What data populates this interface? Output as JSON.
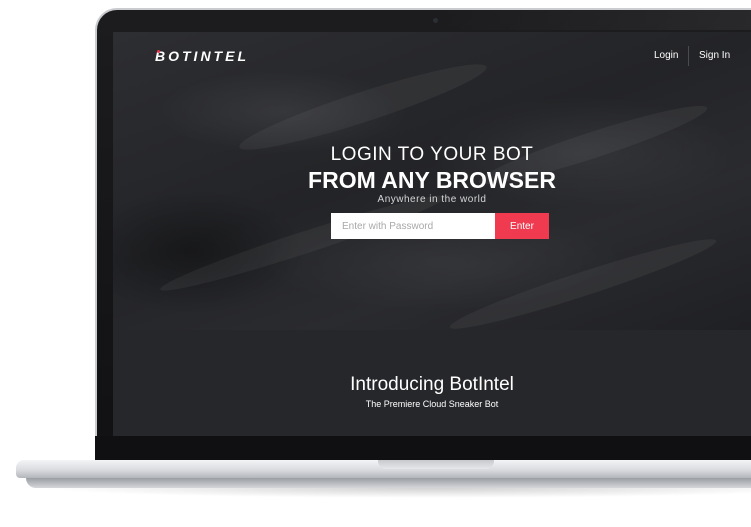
{
  "nav": {
    "logo": "BOTINTEL",
    "login_label": "Login",
    "signin_label": "Sign In"
  },
  "hero": {
    "headline_line1": "LOGIN TO YOUR BOT",
    "headline_line2": "FROM ANY BROWSER",
    "tagline": "Anywhere in the world",
    "password_placeholder": "Enter with Password",
    "password_value": "",
    "enter_label": "Enter"
  },
  "intro": {
    "title": "Introducing BotIntel",
    "subtitle": "The Premiere Cloud Sneaker Bot"
  },
  "colors": {
    "accent": "#ef3a4f",
    "background": "#232427"
  }
}
